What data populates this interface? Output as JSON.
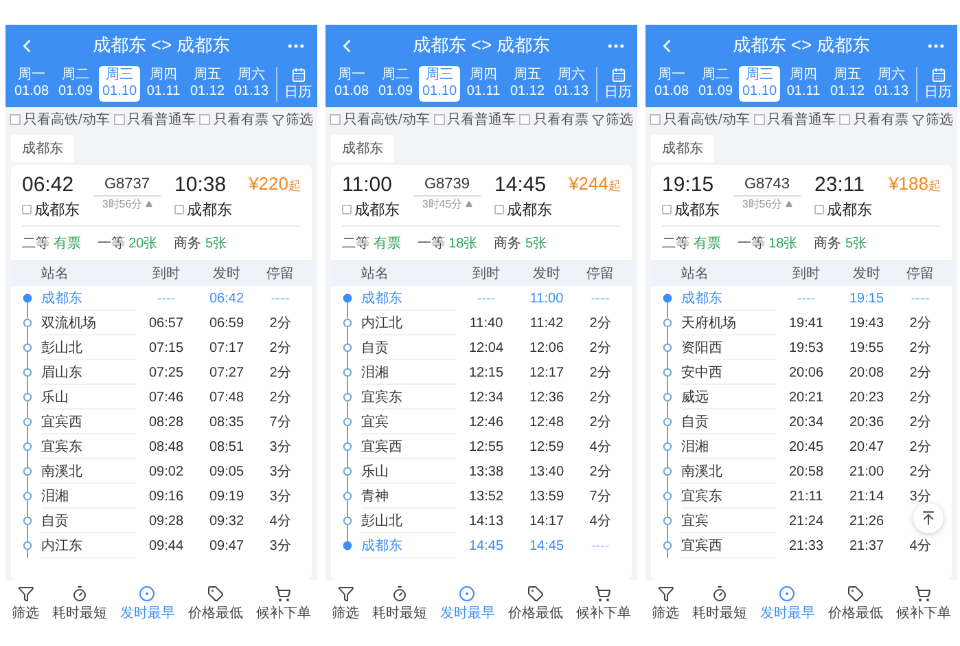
{
  "screens": [
    {
      "title": "成都东 <> 成都东",
      "dates": [
        {
          "weekday": "周一",
          "date": "01.08",
          "selected": false
        },
        {
          "weekday": "周二",
          "date": "01.09",
          "selected": false
        },
        {
          "weekday": "周三",
          "date": "01.10",
          "selected": true
        },
        {
          "weekday": "周四",
          "date": "01.11",
          "selected": false
        },
        {
          "weekday": "周五",
          "date": "01.12",
          "selected": false
        },
        {
          "weekday": "周六",
          "date": "01.13",
          "selected": false
        }
      ],
      "calendar_label": "日历",
      "filters": [
        {
          "label": "只看高铁/动车",
          "checked": false
        },
        {
          "label": "只看普通车",
          "checked": false
        },
        {
          "label": "只看有票",
          "checked": false
        }
      ],
      "filter_button": "筛选",
      "station_chip": "成都东",
      "train": {
        "depart_time": "06:42",
        "depart_station": "成都东",
        "number": "G8737",
        "duration": "3时56分",
        "arrive_time": "10:38",
        "arrive_station": "成都东",
        "price": "¥220",
        "price_suffix": "起"
      },
      "seats": [
        {
          "class": "二等",
          "availability": "有票"
        },
        {
          "class": "一等",
          "availability": "20张"
        },
        {
          "class": "商务",
          "availability": "5张"
        }
      ],
      "columns": [
        "站名",
        "到时",
        "发时",
        "停留"
      ],
      "stops": [
        {
          "name": "成都东",
          "arrive": "----",
          "depart": "06:42",
          "stop": "----",
          "highlighted": true
        },
        {
          "name": "双流机场",
          "arrive": "06:57",
          "depart": "06:59",
          "stop": "2分",
          "highlighted": false
        },
        {
          "name": "彭山北",
          "arrive": "07:15",
          "depart": "07:17",
          "stop": "2分",
          "highlighted": false
        },
        {
          "name": "眉山东",
          "arrive": "07:25",
          "depart": "07:27",
          "stop": "2分",
          "highlighted": false
        },
        {
          "name": "乐山",
          "arrive": "07:46",
          "depart": "07:48",
          "stop": "2分",
          "highlighted": false
        },
        {
          "name": "宜宾西",
          "arrive": "08:28",
          "depart": "08:35",
          "stop": "7分",
          "highlighted": false
        },
        {
          "name": "宜宾东",
          "arrive": "08:48",
          "depart": "08:51",
          "stop": "3分",
          "highlighted": false
        },
        {
          "name": "南溪北",
          "arrive": "09:02",
          "depart": "09:05",
          "stop": "3分",
          "highlighted": false
        },
        {
          "name": "泪湘",
          "arrive": "09:16",
          "depart": "09:19",
          "stop": "3分",
          "highlighted": false
        },
        {
          "name": "自贡",
          "arrive": "09:28",
          "depart": "09:32",
          "stop": "4分",
          "highlighted": false
        },
        {
          "name": "内江东",
          "arrive": "09:44",
          "depart": "09:47",
          "stop": "3分",
          "highlighted": false
        }
      ],
      "nav": [
        {
          "label": "筛选",
          "selected": false
        },
        {
          "label": "耗时最短",
          "selected": false
        },
        {
          "label": "发时最早",
          "selected": true
        },
        {
          "label": "价格最低",
          "selected": false
        },
        {
          "label": "候补下单",
          "selected": false
        }
      ]
    },
    {
      "title": "成都东 <> 成都东",
      "dates": [
        {
          "weekday": "周一",
          "date": "01.08",
          "selected": false
        },
        {
          "weekday": "周二",
          "date": "01.09",
          "selected": false
        },
        {
          "weekday": "周三",
          "date": "01.10",
          "selected": true
        },
        {
          "weekday": "周四",
          "date": "01.11",
          "selected": false
        },
        {
          "weekday": "周五",
          "date": "01.12",
          "selected": false
        },
        {
          "weekday": "周六",
          "date": "01.13",
          "selected": false
        }
      ],
      "calendar_label": "日历",
      "filters": [
        {
          "label": "只看高铁/动车",
          "checked": false
        },
        {
          "label": "只看普通车",
          "checked": false
        },
        {
          "label": "只看有票",
          "checked": false
        }
      ],
      "filter_button": "筛选",
      "station_chip": "成都东",
      "train": {
        "depart_time": "11:00",
        "depart_station": "成都东",
        "number": "G8739",
        "duration": "3时45分",
        "arrive_time": "14:45",
        "arrive_station": "成都东",
        "price": "¥244",
        "price_suffix": "起"
      },
      "seats": [
        {
          "class": "二等",
          "availability": "有票"
        },
        {
          "class": "一等",
          "availability": "18张"
        },
        {
          "class": "商务",
          "availability": "5张"
        }
      ],
      "columns": [
        "站名",
        "到时",
        "发时",
        "停留"
      ],
      "stops": [
        {
          "name": "成都东",
          "arrive": "----",
          "depart": "11:00",
          "stop": "----",
          "highlighted": true
        },
        {
          "name": "内江北",
          "arrive": "11:40",
          "depart": "11:42",
          "stop": "2分",
          "highlighted": false
        },
        {
          "name": "自贡",
          "arrive": "12:04",
          "depart": "12:06",
          "stop": "2分",
          "highlighted": false
        },
        {
          "name": "泪湘",
          "arrive": "12:15",
          "depart": "12:17",
          "stop": "2分",
          "highlighted": false
        },
        {
          "name": "宜宾东",
          "arrive": "12:34",
          "depart": "12:36",
          "stop": "2分",
          "highlighted": false
        },
        {
          "name": "宜宾",
          "arrive": "12:46",
          "depart": "12:48",
          "stop": "2分",
          "highlighted": false
        },
        {
          "name": "宜宾西",
          "arrive": "12:55",
          "depart": "12:59",
          "stop": "4分",
          "highlighted": false
        },
        {
          "name": "乐山",
          "arrive": "13:38",
          "depart": "13:40",
          "stop": "2分",
          "highlighted": false
        },
        {
          "name": "青神",
          "arrive": "13:52",
          "depart": "13:59",
          "stop": "7分",
          "highlighted": false
        },
        {
          "name": "彭山北",
          "arrive": "14:13",
          "depart": "14:17",
          "stop": "4分",
          "highlighted": false
        },
        {
          "name": "成都东",
          "arrive": "14:45",
          "depart": "14:45",
          "stop": "----",
          "highlighted": true
        }
      ],
      "nav": [
        {
          "label": "筛选",
          "selected": false
        },
        {
          "label": "耗时最短",
          "selected": false
        },
        {
          "label": "发时最早",
          "selected": true
        },
        {
          "label": "价格最低",
          "selected": false
        },
        {
          "label": "候补下单",
          "selected": false
        }
      ]
    },
    {
      "title": "成都东 <> 成都东",
      "dates": [
        {
          "weekday": "周一",
          "date": "01.08",
          "selected": false
        },
        {
          "weekday": "周二",
          "date": "01.09",
          "selected": false
        },
        {
          "weekday": "周三",
          "date": "01.10",
          "selected": true
        },
        {
          "weekday": "周四",
          "date": "01.11",
          "selected": false
        },
        {
          "weekday": "周五",
          "date": "01.12",
          "selected": false
        },
        {
          "weekday": "周六",
          "date": "01.13",
          "selected": false
        }
      ],
      "calendar_label": "日历",
      "filters": [
        {
          "label": "只看高铁/动车",
          "checked": false
        },
        {
          "label": "只看普通车",
          "checked": false
        },
        {
          "label": "只看有票",
          "checked": false
        }
      ],
      "filter_button": "筛选",
      "station_chip": "成都东",
      "train": {
        "depart_time": "19:15",
        "depart_station": "成都东",
        "number": "G8743",
        "duration": "3时56分",
        "arrive_time": "23:11",
        "arrive_station": "成都东",
        "price": "¥188",
        "price_suffix": "起"
      },
      "seats": [
        {
          "class": "二等",
          "availability": "有票"
        },
        {
          "class": "一等",
          "availability": "18张"
        },
        {
          "class": "商务",
          "availability": "5张"
        }
      ],
      "columns": [
        "站名",
        "到时",
        "发时",
        "停留"
      ],
      "stops": [
        {
          "name": "成都东",
          "arrive": "----",
          "depart": "19:15",
          "stop": "----",
          "highlighted": true
        },
        {
          "name": "天府机场",
          "arrive": "19:41",
          "depart": "19:43",
          "stop": "2分",
          "highlighted": false
        },
        {
          "name": "资阳西",
          "arrive": "19:53",
          "depart": "19:55",
          "stop": "2分",
          "highlighted": false
        },
        {
          "name": "安中西",
          "arrive": "20:06",
          "depart": "20:08",
          "stop": "2分",
          "highlighted": false
        },
        {
          "name": "威远",
          "arrive": "20:21",
          "depart": "20:23",
          "stop": "2分",
          "highlighted": false
        },
        {
          "name": "自贡",
          "arrive": "20:34",
          "depart": "20:36",
          "stop": "2分",
          "highlighted": false
        },
        {
          "name": "泪湘",
          "arrive": "20:45",
          "depart": "20:47",
          "stop": "2分",
          "highlighted": false
        },
        {
          "name": "南溪北",
          "arrive": "20:58",
          "depart": "21:00",
          "stop": "2分",
          "highlighted": false
        },
        {
          "name": "宜宾东",
          "arrive": "21:11",
          "depart": "21:14",
          "stop": "3分",
          "highlighted": false
        },
        {
          "name": "宜宾",
          "arrive": "21:24",
          "depart": "21:26",
          "highlighted": false
        },
        {
          "name": "宜宾西",
          "arrive": "21:33",
          "depart": "21:37",
          "stop": "4分",
          "highlighted": false
        }
      ],
      "back_to_top": true,
      "nav": [
        {
          "label": "筛选",
          "selected": false
        },
        {
          "label": "耗时最短",
          "selected": false
        },
        {
          "label": "发时最早",
          "selected": true
        },
        {
          "label": "价格最低",
          "selected": false
        },
        {
          "label": "候补下单",
          "selected": false
        }
      ]
    }
  ]
}
